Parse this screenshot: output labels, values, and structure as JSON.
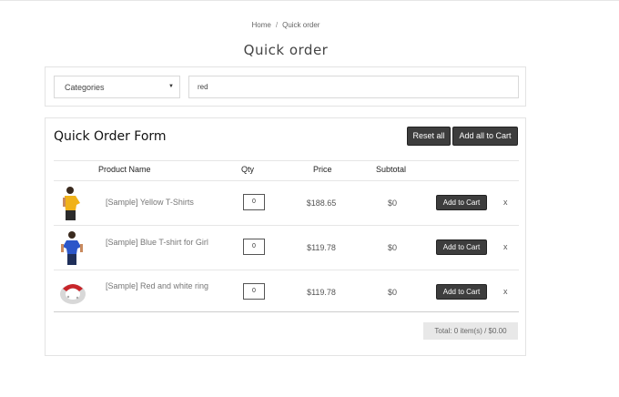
{
  "breadcrumb": {
    "home": "Home",
    "separator": "/",
    "current": "Quick order"
  },
  "page_title": "Quick order",
  "filters": {
    "category_selected": "Categories",
    "search_value": "red"
  },
  "form": {
    "title": "Quick Order Form",
    "reset_label": "Reset all",
    "add_all_label": "Add all to Cart",
    "columns": {
      "name": "Product Name",
      "qty": "Qty",
      "price": "Price",
      "subtotal": "Subtotal"
    },
    "rows": [
      {
        "name": "[Sample] Yellow T-Shirts",
        "qty": "0",
        "price": "$188.65",
        "subtotal": "$0",
        "cart_label": "Add to Cart",
        "remove": "x",
        "icon": "yellow-tshirt-model"
      },
      {
        "name": "[Sample] Blue T-shirt for Girl",
        "qty": "0",
        "price": "$119.78",
        "subtotal": "$0",
        "cart_label": "Add to Cart",
        "remove": "x",
        "icon": "blue-tshirt-model"
      },
      {
        "name": "[Sample] Red and white ring",
        "qty": "0",
        "price": "$119.78",
        "subtotal": "$0",
        "cart_label": "Add to Cart",
        "remove": "x",
        "icon": "red-white-ring"
      }
    ],
    "total": "Total: 0 item(s) / $0.00"
  },
  "colors": {
    "button_bg": "#3d3d3d",
    "border": "#e3e3e3",
    "total_bg": "#e8e8e8"
  }
}
